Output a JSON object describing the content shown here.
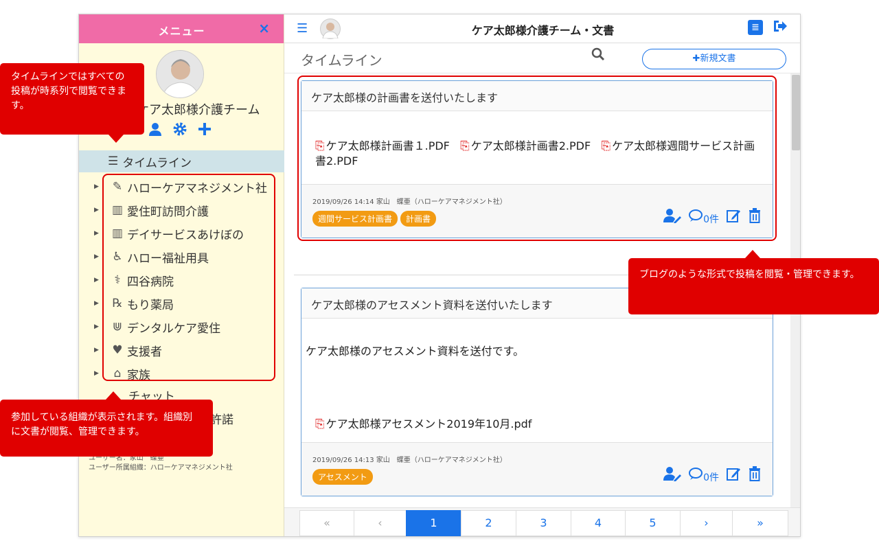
{
  "sidebar": {
    "title": "メニュー",
    "close_icon": "×",
    "team_name": "ケア太郎様介護チーム",
    "timeline_label": "タイムライン",
    "orgs": [
      {
        "label": "ハローケアマネジメント社",
        "icon": "✎"
      },
      {
        "label": "愛住町訪問介護",
        "icon": "▥"
      },
      {
        "label": "デイサービスあけぼの",
        "icon": "▥"
      },
      {
        "label": "ハロー福祉用具",
        "icon": "♿"
      },
      {
        "label": "四谷病院",
        "icon": "⚕"
      },
      {
        "label": "もり薬局",
        "icon": "℞"
      },
      {
        "label": "デンタルケア愛住",
        "icon": "⋓"
      },
      {
        "label": "支援者",
        "icon": "♥"
      },
      {
        "label": "家族",
        "icon": "⌂"
      }
    ],
    "chat_label": "チャット",
    "permission_label": "用許諾",
    "user_name": "ユーザー名：家山　蝶亜",
    "user_org": "ユーザー所属組織：ハローケアマネジメント社"
  },
  "topbar": {
    "title": "ケア太郎様介護チーム・文書"
  },
  "subbar": {
    "title": "タイムライン",
    "new_doc": "✚新規文書"
  },
  "posts": [
    {
      "title": "ケア太郎様の計画書を送付いたします",
      "files": [
        "ケア太郎様計画書１.PDF",
        "ケア太郎様計画書2.PDF",
        "ケア太郎様週間サービス計画書2.PDF"
      ],
      "meta": "2019/09/26 14:14  家山　蝶亜（ハローケアマネジメント社）",
      "tags": [
        "週間サービス計画書",
        "計画書"
      ],
      "comment_count": "0件"
    },
    {
      "title": "ケア太郎様のアセスメント資料を送付いたします",
      "body": "ケア太郎様のアセスメント資料を送付です。",
      "files": [
        "ケア太郎様アセスメント2019年10月.pdf"
      ],
      "meta": "2019/09/26 14:13  家山　蝶亜（ハローケアマネジメント社）",
      "tags": [
        "アセスメント"
      ],
      "comment_count": "0件"
    }
  ],
  "pager": {
    "first": "«",
    "prev": "‹",
    "pages": [
      "1",
      "2",
      "3",
      "4",
      "5"
    ],
    "next": "›",
    "last": "»",
    "active": "1"
  },
  "callouts": {
    "timeline": "タイムラインではすべての投稿が時系列で閲覧できます。",
    "blog": "ブログのような形式で投稿を閲覧・管理できます。",
    "orgs": "参加している組織が表示されます。組織別に文書が閲覧、管理できます。"
  },
  "colors": {
    "sidebar_header": "#f06ba7",
    "sidebar_bg": "#fffbdd",
    "accent": "#1a73e8",
    "tag": "#f29b13",
    "annotation": "#e00000"
  }
}
